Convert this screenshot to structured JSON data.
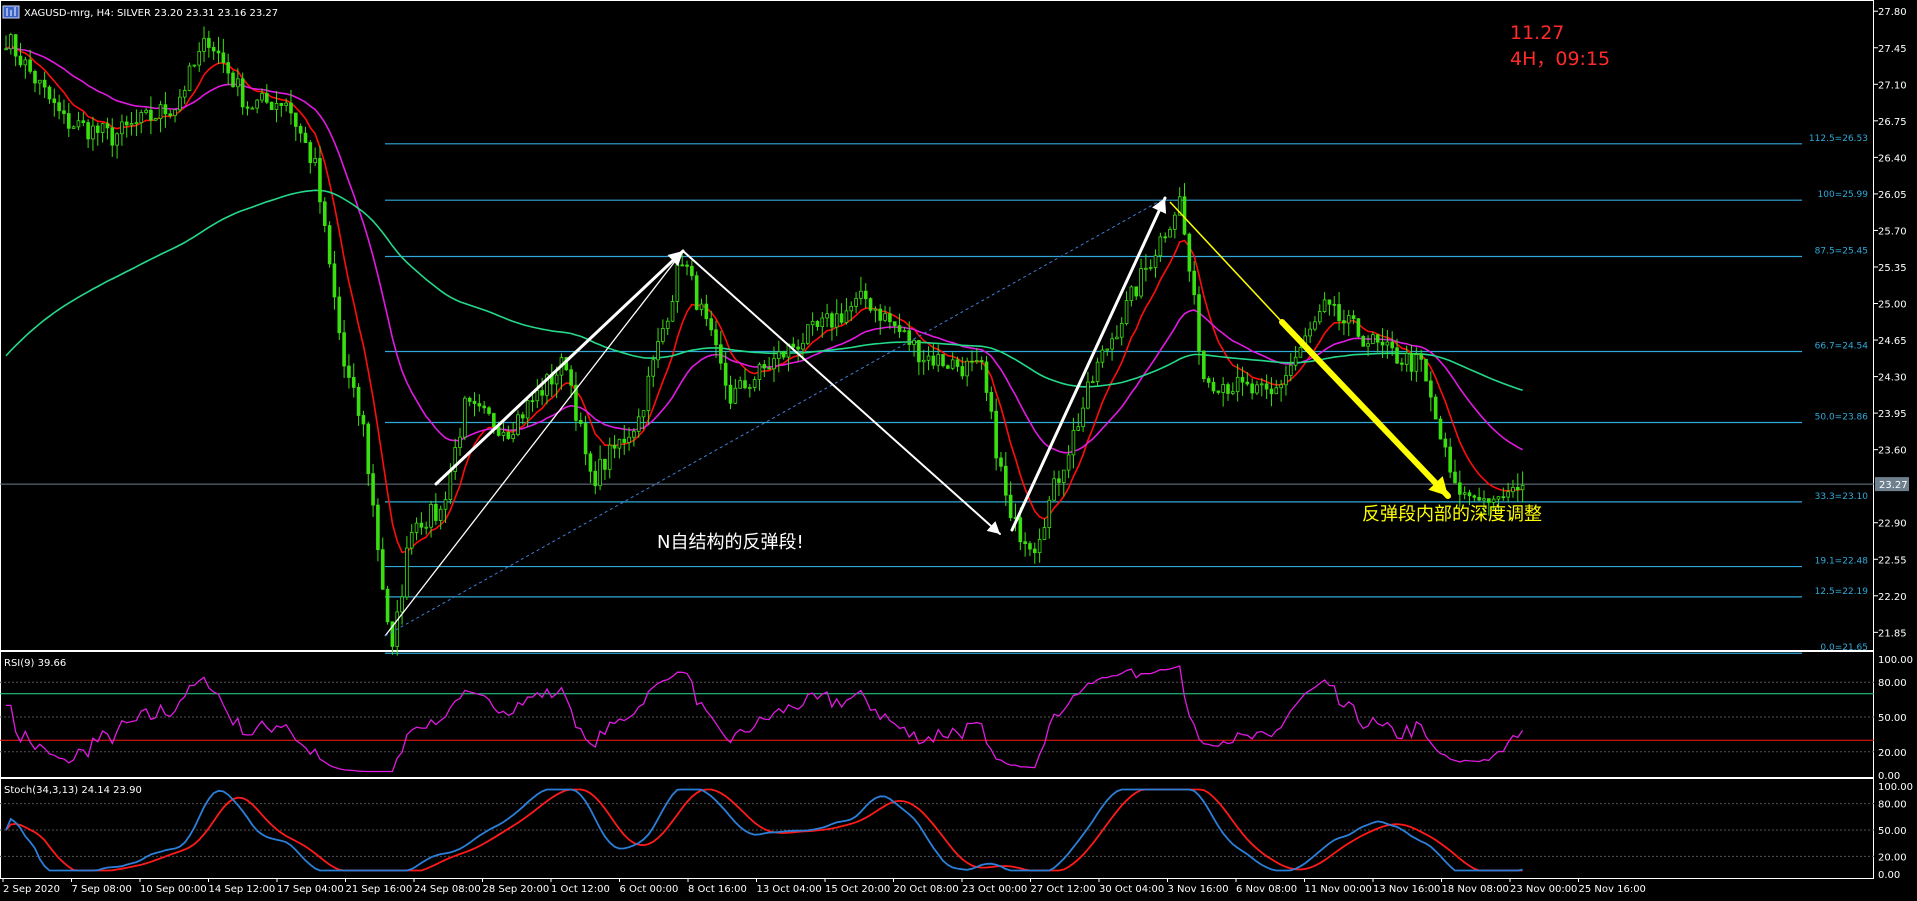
{
  "header": {
    "symbol_info": "XAGUSD-mrg, H4:  SILVER  23.20 23.31 23.16 23.27",
    "symbol_icon": "chart-window-icon"
  },
  "annotations": {
    "date_label": "11.27",
    "time_label": "4H，09:15",
    "n_structure_text": "N自结构的反弹段!",
    "deep_adjust_text": "反弹段内部的深度调整",
    "text_colors": {
      "red": "#ff2a2a",
      "white": "#ffffff",
      "yellow": "#ffff00"
    }
  },
  "colors": {
    "background": "#000000",
    "candles": "#3adf10",
    "ema_red": "#ff0d0d",
    "ma_magenta": "#e01ae0",
    "ma_green": "#25d98a",
    "fib_lines": "#31a9d8",
    "rsi_line": "#e01ae0",
    "stoch_main": "#2c7fd8",
    "stoch_signal": "#ff1a1a",
    "arrow_white": "#ffffff",
    "arrow_yellow": "#ffff00",
    "current_price_line": "#6e7f8e"
  },
  "price_axis": {
    "labels": [
      "27.80",
      "27.45",
      "27.10",
      "26.75",
      "26.40",
      "26.05",
      "25.70",
      "25.35",
      "25.00",
      "24.65",
      "24.30",
      "23.95",
      "23.60",
      "22.90",
      "22.55",
      "22.20",
      "21.85"
    ],
    "current_price": "23.27",
    "range": [
      21.7,
      27.85
    ]
  },
  "fib_levels": [
    {
      "label": "112.5=26.53",
      "price": 26.53
    },
    {
      "label": "100=25.99",
      "price": 25.99
    },
    {
      "label": "87.5=25.45",
      "price": 25.45
    },
    {
      "label": "66.7=24.54",
      "price": 24.54
    },
    {
      "label": "50.0=23.86",
      "price": 23.86
    },
    {
      "label": "33.3=23.10",
      "price": 23.1
    },
    {
      "label": "19.1=22.48",
      "price": 22.48
    },
    {
      "label": "12.5=22.19",
      "price": 22.19
    },
    {
      "label": "0.0=21.65",
      "price": 21.65
    }
  ],
  "rsi": {
    "title": "RSI(9) 39.66",
    "labels": [
      "100.00",
      "80.00",
      "50.00",
      "20.00",
      "0.00"
    ]
  },
  "stoch": {
    "title": "Stoch(34,3,13) 24.14 23.90",
    "labels": [
      "100.00",
      "80.00",
      "50.00",
      "20.00",
      "0.00"
    ]
  },
  "time_axis": {
    "labels": [
      "2 Sep 2020",
      "7 Sep 08:00",
      "10 Sep 00:00",
      "14 Sep 12:00",
      "17 Sep 04:00",
      "21 Sep 16:00",
      "24 Sep 08:00",
      "28 Sep 20:00",
      "1 Oct 12:00",
      "6 Oct 00:00",
      "8 Oct 16:00",
      "13 Oct 04:00",
      "15 Oct 20:00",
      "20 Oct 08:00",
      "23 Oct 00:00",
      "27 Oct 12:00",
      "30 Oct 04:00",
      "3 Nov 16:00",
      "6 Nov 08:00",
      "11 Nov 00:00",
      "13 Nov 16:00",
      "18 Nov 08:00",
      "23 Nov 00:00",
      "25 Nov 16:00"
    ]
  },
  "chart_data": {
    "type": "candlestick",
    "title": "XAGUSD-mrg, H4:  SILVER  23.20 23.31 23.16 23.27",
    "ylim": [
      21.7,
      27.85
    ],
    "price_path": [
      {
        "bar": 0,
        "price": 27.55
      },
      {
        "bar": 12,
        "price": 26.75
      },
      {
        "bar": 22,
        "price": 26.6
      },
      {
        "bar": 35,
        "price": 26.9
      },
      {
        "bar": 42,
        "price": 27.55
      },
      {
        "bar": 50,
        "price": 26.9
      },
      {
        "bar": 58,
        "price": 26.95
      },
      {
        "bar": 64,
        "price": 26.3
      },
      {
        "bar": 70,
        "price": 24.4
      },
      {
        "bar": 74,
        "price": 23.8
      },
      {
        "bar": 78,
        "price": 22.3
      },
      {
        "bar": 80,
        "price": 21.65
      },
      {
        "bar": 84,
        "price": 22.9
      },
      {
        "bar": 90,
        "price": 23.0
      },
      {
        "bar": 95,
        "price": 24.0
      },
      {
        "bar": 104,
        "price": 23.8
      },
      {
        "bar": 116,
        "price": 24.45
      },
      {
        "bar": 121,
        "price": 23.3
      },
      {
        "bar": 131,
        "price": 23.9
      },
      {
        "bar": 140,
        "price": 25.45
      },
      {
        "bar": 150,
        "price": 24.1
      },
      {
        "bar": 163,
        "price": 24.6
      },
      {
        "bar": 178,
        "price": 25.05
      },
      {
        "bar": 190,
        "price": 24.5
      },
      {
        "bar": 202,
        "price": 24.35
      },
      {
        "bar": 208,
        "price": 22.9
      },
      {
        "bar": 213,
        "price": 22.7
      },
      {
        "bar": 226,
        "price": 24.4
      },
      {
        "bar": 243,
        "price": 25.99
      },
      {
        "bar": 248,
        "price": 24.3
      },
      {
        "bar": 262,
        "price": 24.1
      },
      {
        "bar": 273,
        "price": 24.95
      },
      {
        "bar": 285,
        "price": 24.55
      },
      {
        "bar": 293,
        "price": 24.4
      },
      {
        "bar": 300,
        "price": 23.2
      },
      {
        "bar": 308,
        "price": 23.1
      },
      {
        "bar": 314,
        "price": 23.27
      }
    ]
  }
}
